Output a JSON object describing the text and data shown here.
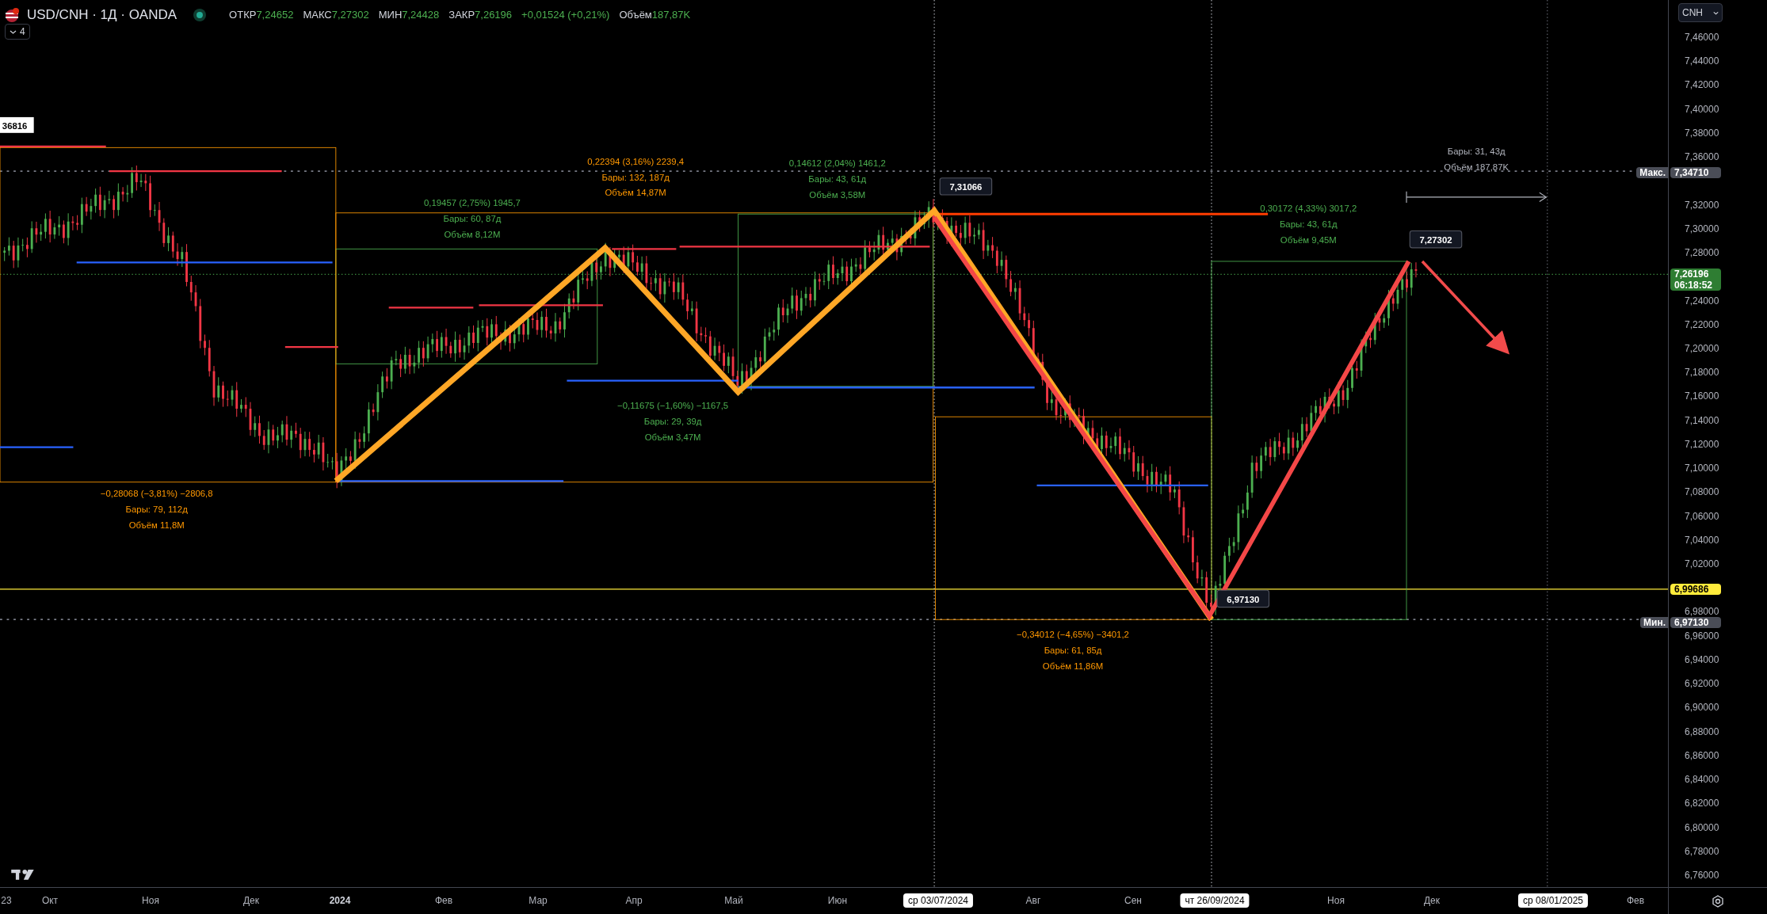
{
  "header": {
    "symbol": "USD/CNH · 1Д · OANDA",
    "quote": [
      {
        "label": "ОТКР",
        "value": "7,24652"
      },
      {
        "label": "МАКС",
        "value": "7,27302"
      },
      {
        "label": "МИН",
        "value": "7,24428"
      },
      {
        "label": "ЗАКР",
        "value": "7,26196"
      }
    ],
    "change": "+0,01524 (+0,21%)",
    "volume": {
      "label": "Объём",
      "value": "187,87K"
    },
    "indicators_toggle": "4"
  },
  "currency": "CNH",
  "price_axis": [
    "7,46000",
    "7,44000",
    "7,42000",
    "7,40000",
    "7,38000",
    "7,36000",
    "7,32000",
    "7,30000",
    "7,28000",
    "7,24000",
    "7,22000",
    "7,20000",
    "7,18000",
    "7,16000",
    "7,14000",
    "7,12000",
    "7,10000",
    "7,08000",
    "7,06000",
    "7,04000",
    "7,02000",
    "6,98000",
    "6,96000",
    "6,94000",
    "6,92000",
    "6,90000",
    "6,88000",
    "6,86000",
    "6,84000",
    "6,82000",
    "6,80000",
    "6,78000",
    "6,76000"
  ],
  "price_tags": [
    {
      "kind": "max",
      "caption": "Макс.",
      "value": "7,34710"
    },
    {
      "kind": "current",
      "value": "7,26196",
      "countdown": "06:18:52"
    },
    {
      "kind": "line",
      "value": "6,99686"
    },
    {
      "kind": "min",
      "caption": "Мин.",
      "value": "6,97130"
    }
  ],
  "time_axis": [
    {
      "label": "23",
      "kind": "month"
    },
    {
      "label": "Окт",
      "kind": "month"
    },
    {
      "label": "Ноя",
      "kind": "month"
    },
    {
      "label": "Дек",
      "kind": "month"
    },
    {
      "label": "2024",
      "kind": "year"
    },
    {
      "label": "Фев",
      "kind": "month"
    },
    {
      "label": "Мар",
      "kind": "month"
    },
    {
      "label": "Апр",
      "kind": "month"
    },
    {
      "label": "Май",
      "kind": "month"
    },
    {
      "label": "Июн",
      "kind": "month"
    },
    {
      "label": "ср 03/07/2024",
      "kind": "date"
    },
    {
      "label": "Авг",
      "kind": "month"
    },
    {
      "label": "Сен",
      "kind": "month"
    },
    {
      "label": "чт 26/09/2024",
      "kind": "date"
    },
    {
      "label": "Ноя",
      "kind": "month"
    },
    {
      "label": "Дек",
      "kind": "month"
    },
    {
      "label": "ср 08/01/2025",
      "kind": "date"
    },
    {
      "label": "Фев",
      "kind": "month"
    }
  ],
  "chart": {
    "edge_label": "36816",
    "callouts": [
      "7,31066",
      "7,27302",
      "6,97130"
    ],
    "measures": [
      {
        "color": "#ff9800",
        "lines": [
          "−0,28068 (−3,81%) −2806,8",
          "Бары: 79, 112д",
          "Объём 11,8M"
        ]
      },
      {
        "color": "#4caf50",
        "lines": [
          "0,19457 (2,75%) 1945,7",
          "Бары: 60, 87д",
          "Объём 8,12M"
        ]
      },
      {
        "color": "#ff9800",
        "lines": [
          "0,22394 (3,16%) 2239,4",
          "Бары: 132, 187д",
          "Объём 14,87M"
        ]
      },
      {
        "color": "#4caf50",
        "lines": [
          "0,14612 (2,04%) 1461,2",
          "Бары: 43, 61д",
          "Объём 3,58M"
        ]
      },
      {
        "color": "#4caf50",
        "lines": [
          "−0,11675 (−1,60%) −1167,5",
          "Бары: 29, 39д",
          "Объём 3,47M"
        ]
      },
      {
        "color": "#ff9800",
        "lines": [
          "−0,34012 (−4,65%) −3401,2",
          "Бары: 61, 85д",
          "Объём 11,86M"
        ]
      },
      {
        "color": "#4caf50",
        "lines": [
          "0,30172 (4,33%) 3017,2",
          "Бары: 43, 61д",
          "Объём 9,45M"
        ]
      },
      {
        "color": "#b2b5be",
        "lines": [
          "Бары: 31, 43д",
          "Объём 187,87K"
        ]
      }
    ]
  }
}
